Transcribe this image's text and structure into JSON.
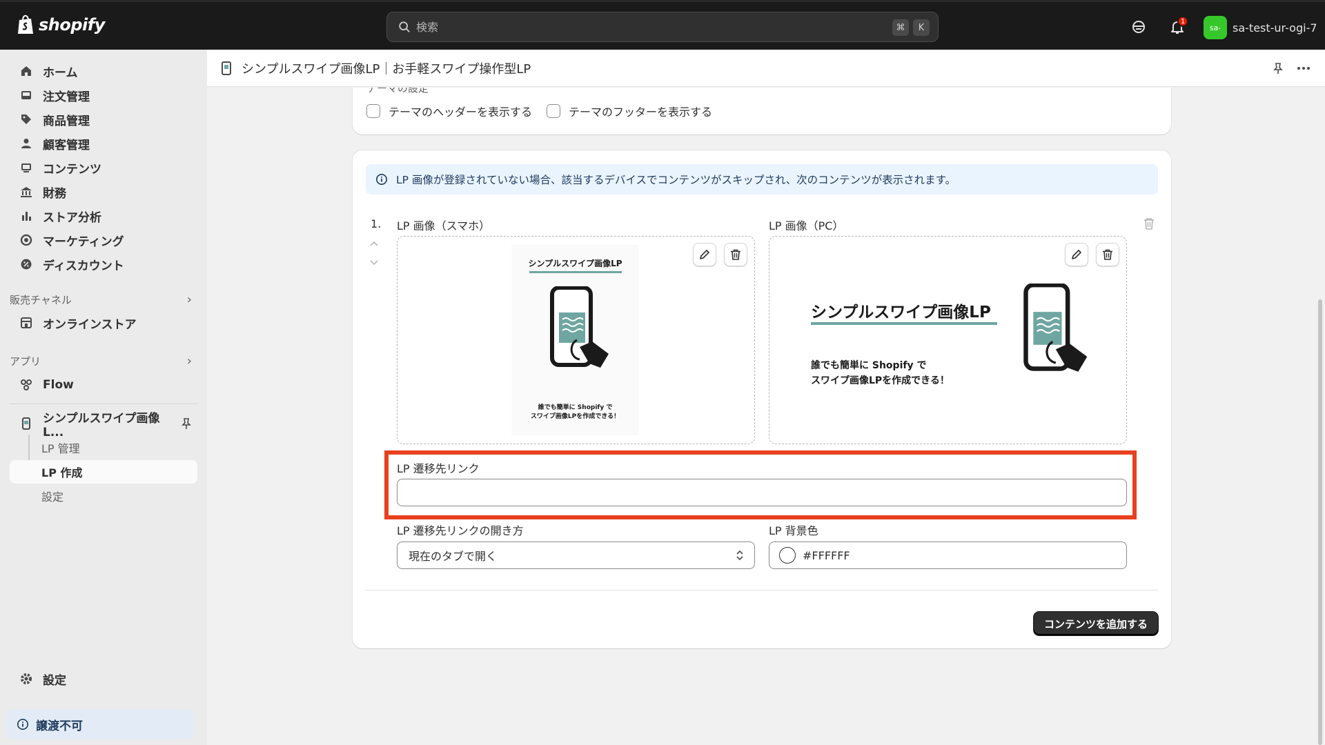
{
  "topbar": {
    "brand": "shopify",
    "search_placeholder": "検索",
    "shortcut_cmd": "⌘",
    "shortcut_key": "K",
    "notification_count": "1",
    "store_avatar": "sa-",
    "store_name": "sa-test-ur-ogi-7"
  },
  "sidebar": {
    "items": [
      {
        "label": "ホーム",
        "icon": "home-icon"
      },
      {
        "label": "注文管理",
        "icon": "inbox-icon"
      },
      {
        "label": "商品管理",
        "icon": "tag-icon"
      },
      {
        "label": "顧客管理",
        "icon": "person-icon"
      },
      {
        "label": "コンテンツ",
        "icon": "image-icon"
      },
      {
        "label": "財務",
        "icon": "bank-icon"
      },
      {
        "label": "ストア分析",
        "icon": "bar-chart-icon"
      },
      {
        "label": "マーケティング",
        "icon": "target-icon"
      },
      {
        "label": "ディスカウント",
        "icon": "discount-icon"
      }
    ],
    "sales_channels_label": "販売チャネル",
    "online_store": "オンラインストア",
    "apps_label": "アプリ",
    "flow": "Flow",
    "app_name": "シンプルスワイプ画像L...",
    "app_sub": [
      "LP 管理",
      "LP 作成",
      "設定"
    ],
    "settings": "設定",
    "notice": "譲渡不可"
  },
  "page": {
    "title": "シンプルスワイプ画像LP｜お手軽スワイプ操作型LP"
  },
  "theme": {
    "section_label": "テーマの設定",
    "show_header": "テーマのヘッダーを表示する",
    "show_footer": "テーマのフッターを表示する"
  },
  "content": {
    "info": "LP 画像が登録されていない場合、該当するデバイスでコンテンツがスキップされ、次のコンテンツが表示されます。",
    "index": "1.",
    "sp_label": "LP 画像（スマホ）",
    "pc_label": "LP 画像（PC）",
    "link_label": "LP 遷移先リンク",
    "link_value": "",
    "open_label": "LP 遷移先リンクの開き方",
    "open_value": "現在のタブで開く",
    "bg_label": "LP 背景色",
    "bg_value": "#FFFFFF",
    "add_button": "コンテンツを追加する"
  },
  "sp_image": {
    "title": "シンプルスワイプ画像LP",
    "line1": "誰でも簡単に Shopify で",
    "line2": "スワイプ画像LPを作成できる！"
  },
  "pc_image": {
    "title": "シンプルスワイプ画像LP",
    "line1": "誰でも簡単に Shopify で",
    "line2": "スワイプ画像LPを作成できる！"
  },
  "colors": {
    "highlight": "#e8401e",
    "teal": "#6fa6a1",
    "topbar": "#1a1a1a"
  }
}
